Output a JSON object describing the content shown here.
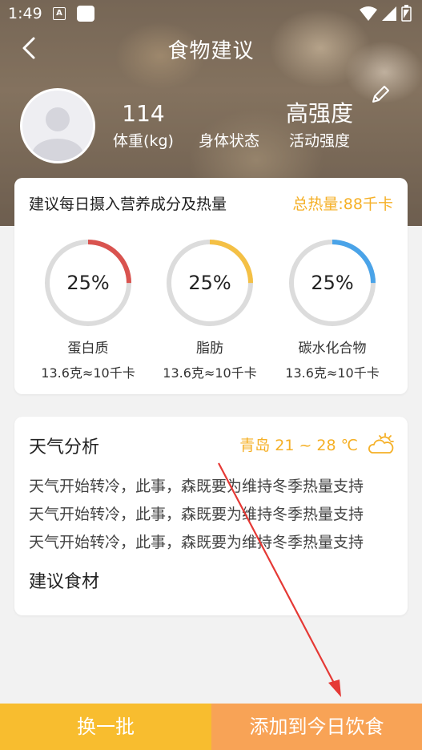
{
  "status_bar": {
    "time": "1:49",
    "notif_glyph": "A"
  },
  "nav": {
    "title": "食物建议",
    "back_icon": "chevron-left-icon"
  },
  "profile": {
    "stats": [
      {
        "value": "114",
        "label": "体重(kg)"
      },
      {
        "value": "",
        "label": "身体状态"
      },
      {
        "value": "高强度",
        "label": "活动强度"
      }
    ]
  },
  "nutrition": {
    "title": "建议每日摄入营养成分及热量",
    "total": "总热量:88千卡",
    "items": [
      {
        "percent": "25%",
        "fraction": 0.25,
        "color": "#d9534f",
        "name": "蛋白质",
        "amount": "13.6克≈10千卡"
      },
      {
        "percent": "25%",
        "fraction": 0.25,
        "color": "#f4c045",
        "name": "脂肪",
        "amount": "13.6克≈10千卡"
      },
      {
        "percent": "25%",
        "fraction": 0.25,
        "color": "#4aa3e8",
        "name": "碳水化合物",
        "amount": "13.6克≈10千卡"
      }
    ]
  },
  "weather": {
    "title": "天气分析",
    "city_temp": "青岛  21 ~ 28 ℃",
    "icon": "cloud-sun-icon",
    "lines": [
      "天气开始转冷，此事，森既要为维持冬季热量支持",
      "天气开始转冷，此事，森既要为维持冬季热量支持",
      "天气开始转冷，此事，森既要为维持冬季热量支持"
    ],
    "suggest_title": "建议食材"
  },
  "buttons": {
    "refresh": "换一批",
    "add": "添加到今日饮食"
  },
  "colors": {
    "accent": "#f5b027",
    "btn_left": "#f8bd2f",
    "btn_right": "#f8a356",
    "annotation_arrow": "#e53935"
  }
}
